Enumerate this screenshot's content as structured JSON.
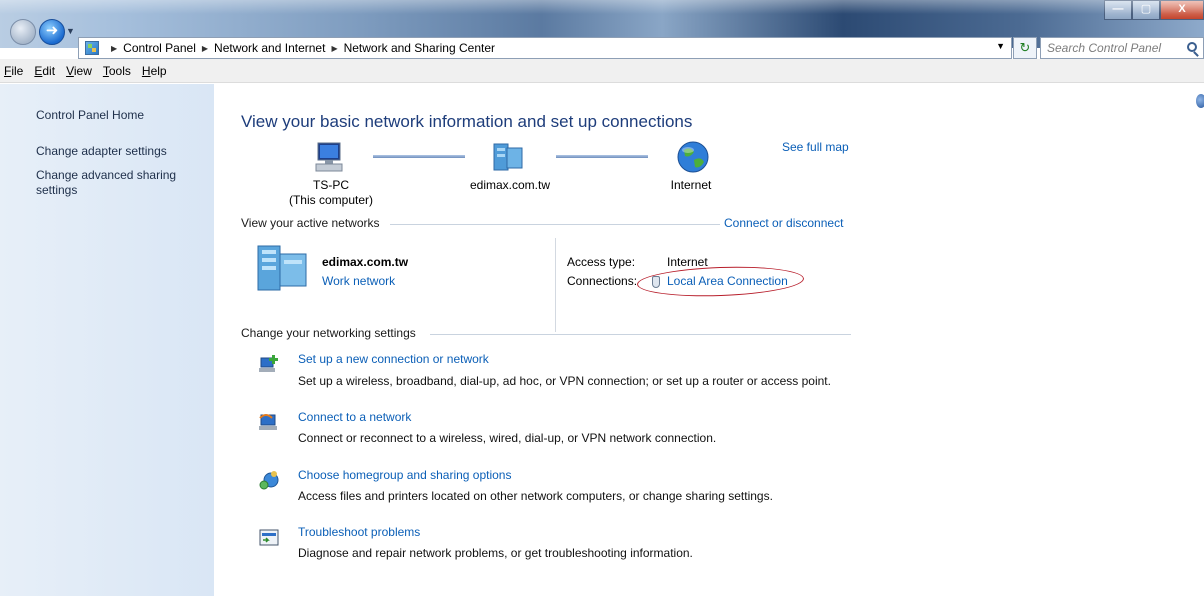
{
  "window": {
    "buttons": {
      "minimize": "—",
      "maximize": "▢",
      "close": "X"
    }
  },
  "address_bar": {
    "crumbs": [
      "Control Panel",
      "Network and Internet",
      "Network and Sharing Center"
    ],
    "search_placeholder": "Search Control Panel"
  },
  "menu": {
    "items": [
      "File",
      "Edit",
      "View",
      "Tools",
      "Help"
    ]
  },
  "sidebar": {
    "home": "Control Panel Home",
    "links": [
      "Change adapter settings",
      "Change advanced sharing settings"
    ]
  },
  "main": {
    "title": "View your basic network information and set up connections",
    "see_full_map": "See full map",
    "map": {
      "computer_name": "TS-PC",
      "computer_sub": "(This computer)",
      "network_name": "edimax.com.tw",
      "internet": "Internet"
    },
    "active_networks": {
      "heading": "View your active networks",
      "connect_link": "Connect or disconnect",
      "network_name": "edimax.com.tw",
      "network_type": "Work network",
      "access_type_label": "Access type:",
      "access_type_value": "Internet",
      "connections_label": "Connections:",
      "connections_value": "Local Area Connection"
    },
    "settings": {
      "heading": "Change your networking settings",
      "tasks": [
        {
          "link": "Set up a new connection or network",
          "desc": "Set up a wireless, broadband, dial-up, ad hoc, or VPN connection; or set up a router or access point.",
          "icon": "new-connection-icon"
        },
        {
          "link": "Connect to a network",
          "desc": "Connect or reconnect to a wireless, wired, dial-up, or VPN network connection.",
          "icon": "connect-network-icon"
        },
        {
          "link": "Choose homegroup and sharing options",
          "desc": "Access files and printers located on other network computers, or change sharing settings.",
          "icon": "homegroup-icon"
        },
        {
          "link": "Troubleshoot problems",
          "desc": "Diagnose and repair network problems, or get troubleshooting information.",
          "icon": "troubleshoot-icon"
        }
      ]
    }
  }
}
